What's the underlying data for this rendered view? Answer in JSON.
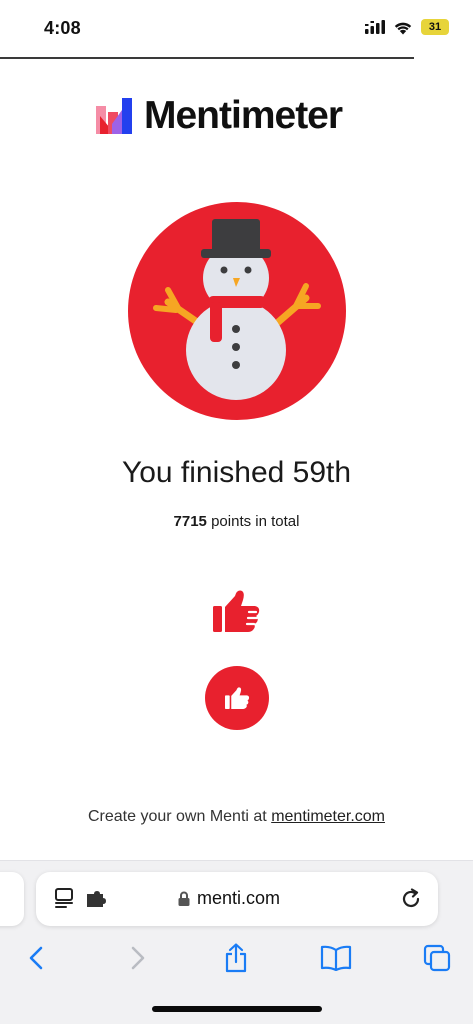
{
  "status_bar": {
    "time": "4:08",
    "battery": "31",
    "icons": [
      "cellular-signal-icon",
      "wifi-icon",
      "battery-icon"
    ]
  },
  "brand": {
    "name": "Mentimeter",
    "logo_icon": "mentimeter-logo-icon"
  },
  "result": {
    "avatar_icon": "snowman-icon",
    "title": "You finished 59th",
    "points_value": "7715",
    "points_suffix": "points in total",
    "reaction_icon": "thumbs-up-icon"
  },
  "footer": {
    "text": "Create your own Menti at",
    "link": "mentimeter.com"
  },
  "browser": {
    "url": "menti.com",
    "address_icons": [
      "page-menu-icon",
      "extension-icon",
      "lock-icon",
      "reload-icon"
    ],
    "toolbar": [
      "back-icon",
      "forward-icon",
      "share-icon",
      "bookmarks-icon",
      "tabs-icon"
    ]
  },
  "colors": {
    "accent_red": "#e8212e",
    "safari_blue": "#1a7cf5",
    "battery_yellow": "#e7d43a"
  }
}
